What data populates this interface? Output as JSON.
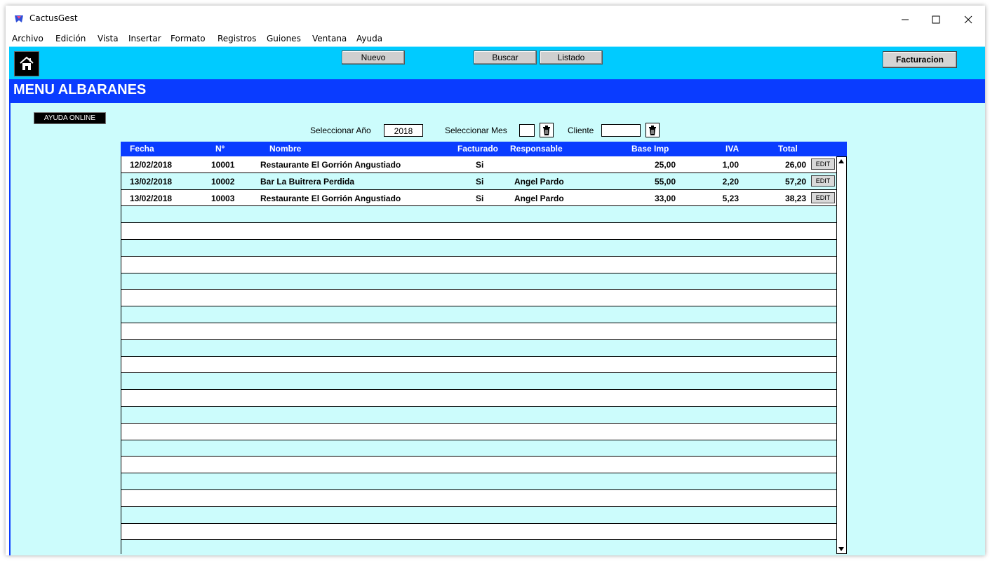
{
  "window": {
    "title": "CactusGest",
    "controls": [
      "minimize-icon",
      "maximize-icon",
      "close-icon"
    ]
  },
  "menubar": [
    "Archivo",
    "Edición",
    "Vista",
    "Insertar",
    "Formato",
    "Registros",
    "Guiones",
    "Ventana",
    "Ayuda"
  ],
  "toolbar": {
    "nuevo": "Nuevo",
    "buscar": "Buscar",
    "listado": "Listado",
    "facturacion": "Facturacion",
    "home_icon": "home-icon"
  },
  "section": {
    "title": "MENU ALBARANES"
  },
  "help_button": "AYUDA ONLINE",
  "filters": {
    "year_label": "Seleccionar Año",
    "year_value": "2018",
    "month_label": "Seleccionar Mes",
    "month_value": "",
    "client_label": "Cliente",
    "client_value": ""
  },
  "table": {
    "headers": [
      "Fecha",
      "Nº",
      "Nombre",
      "Facturado",
      "Responsable",
      "Base Imp",
      "IVA",
      "Total"
    ],
    "edit_label": "EDIT",
    "rows": [
      {
        "fecha": "12/02/2018",
        "num": "10001",
        "nombre": "Restaurante El  Gorrión Angustiado",
        "facturado": "Si",
        "responsable": "",
        "base": "25,00",
        "iva": "1,00",
        "total": "26,00"
      },
      {
        "fecha": "13/02/2018",
        "num": "10002",
        "nombre": "Bar La Buitrera Perdida",
        "facturado": "Si",
        "responsable": "Angel Pardo",
        "base": "55,00",
        "iva": "2,20",
        "total": "57,20"
      },
      {
        "fecha": "13/02/2018",
        "num": "10003",
        "nombre": "Restaurante El  Gorrión Angustiado",
        "facturado": "Si",
        "responsable": "Angel Pardo",
        "base": "33,00",
        "iva": "5,23",
        "total": "38,23"
      }
    ],
    "empty_row_count": 20
  },
  "colors": {
    "toolbar": "#00cbff",
    "header_band": "#0a3cff",
    "content_bg": "#ccfcfc"
  }
}
